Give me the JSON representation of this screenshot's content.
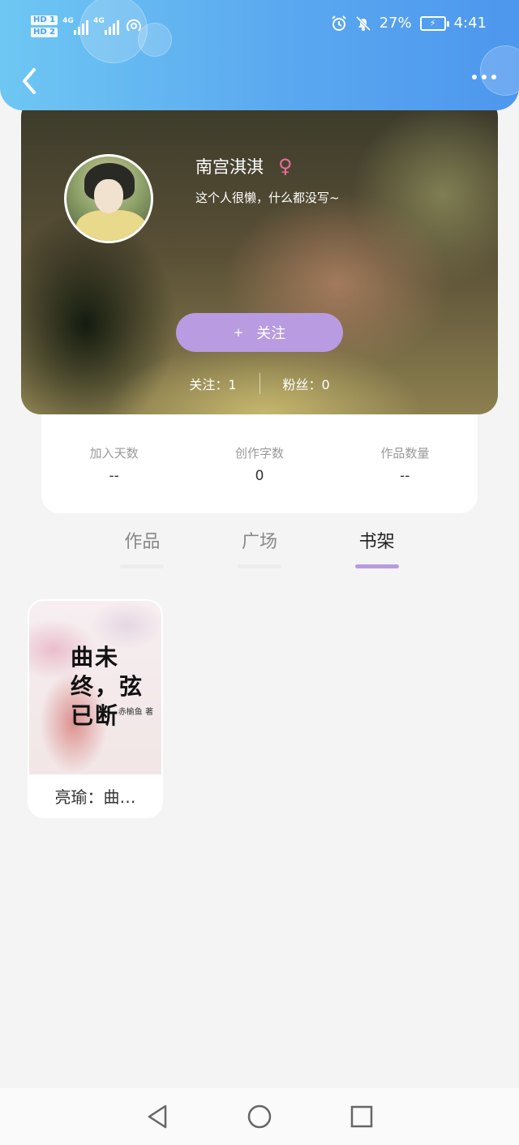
{
  "status_bar": {
    "hd1": "HD 1",
    "hd2": "HD 2",
    "net1": "4G",
    "net2": "4G",
    "battery": "27%",
    "time": "4:41"
  },
  "header": {
    "back_icon": "chevron-left-icon",
    "more_icon": "more-dots-icon"
  },
  "profile": {
    "name": "南宫淇淇",
    "gender_symbol": "♀",
    "bio": "这个人很懒，什么都没写~",
    "follow_plus": "+",
    "follow_label": "关注",
    "following": "关注：1",
    "followers": "粉丝：0"
  },
  "stats": [
    {
      "label": "加入天数",
      "value": "--"
    },
    {
      "label": "创作字数",
      "value": "0"
    },
    {
      "label": "作品数量",
      "value": "--"
    }
  ],
  "tabs": [
    {
      "label": "作品"
    },
    {
      "label": "广场"
    },
    {
      "label": "书架"
    }
  ],
  "active_tab": "书架",
  "bookshelf": [
    {
      "cover_title": "曲未终，弦已断",
      "cover_author": "赤榆鱼 著",
      "title": "亮瑜：曲…"
    }
  ],
  "colors": {
    "header_gradient_start": "#6ec7f2",
    "header_gradient_end": "#4d97ee",
    "accent": "#b89be0",
    "gender": "#e86d9d"
  }
}
